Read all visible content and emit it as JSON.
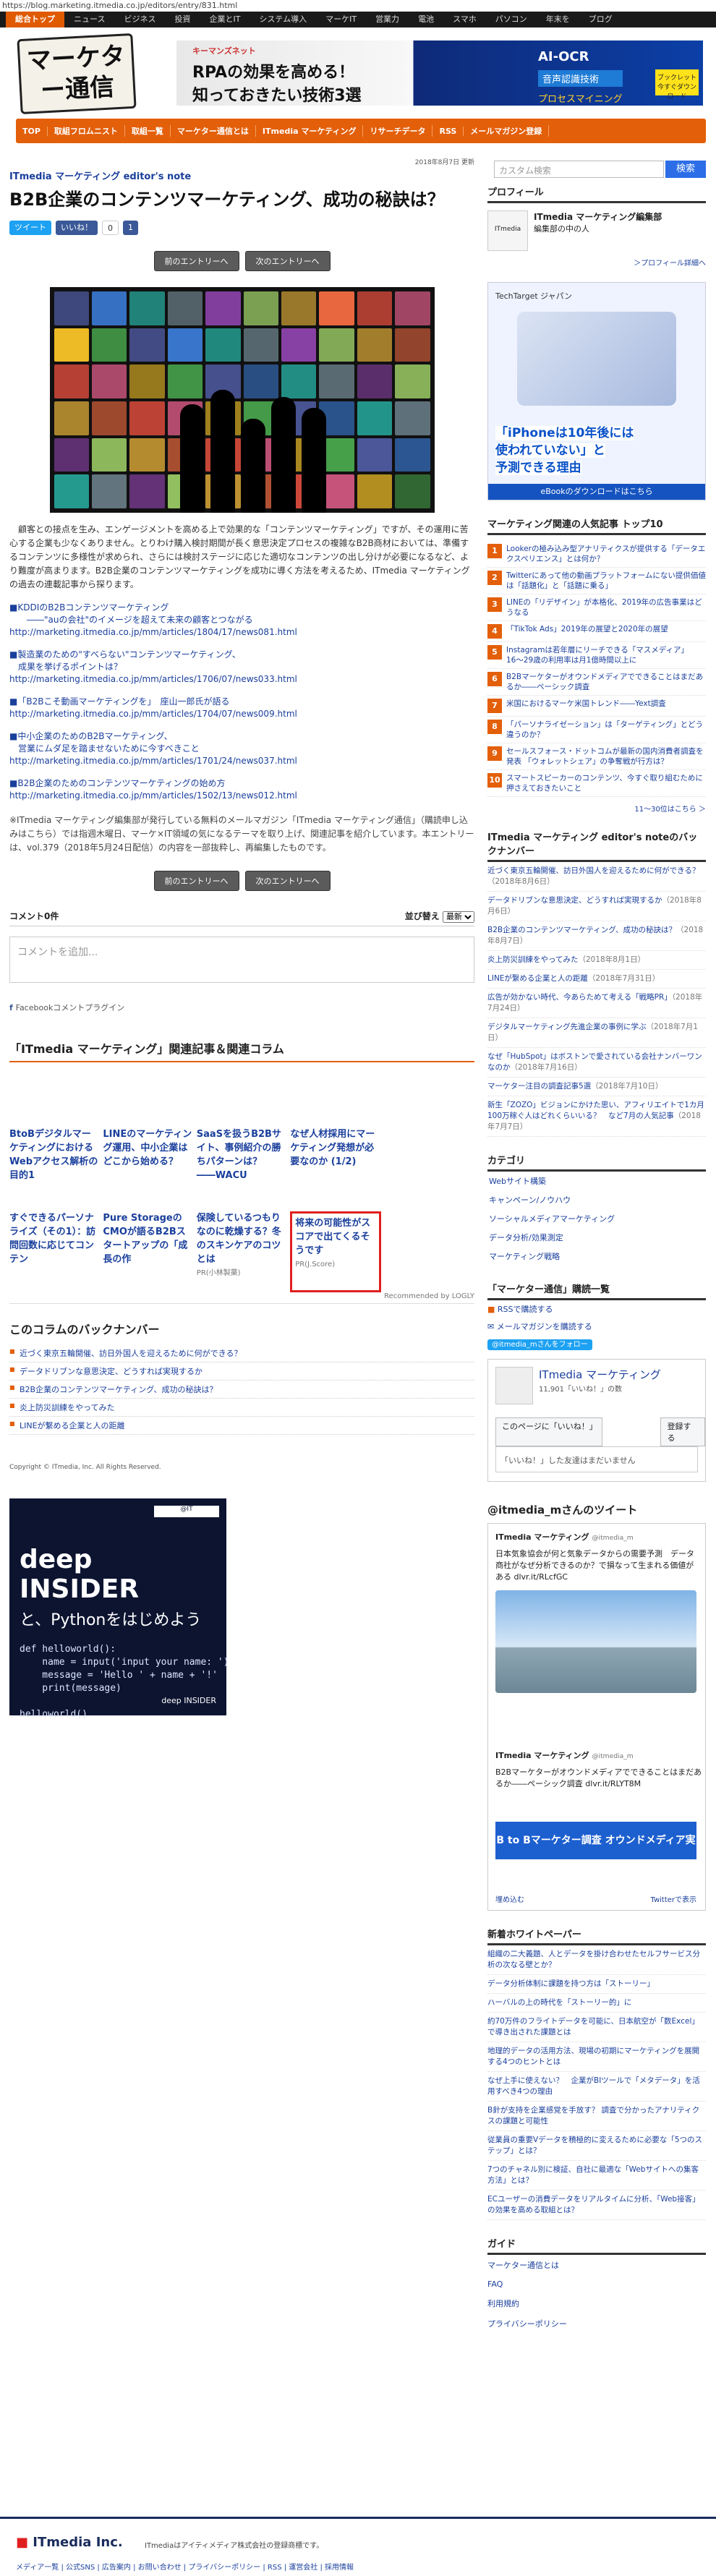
{
  "url": "https://blog.marketing.itmedia.co.jp/editors/entry/831.html",
  "topnav": [
    "総合トップ",
    "ニュース",
    "ビジネス",
    "投資",
    "企業とIT",
    "システム導入",
    "マーケIT",
    "営業力",
    "電池",
    "スマホ",
    "パソコン",
    "年末を",
    "ブログ"
  ],
  "logo_text": "マーケター通信",
  "banner": {
    "brand": "キーマンズネット",
    "line1": "RPAの効果を高める！",
    "line2": "知っておきたい技術3選",
    "ai": "AI-OCR",
    "voice": "音声認識技術",
    "process": "プロセスマイニング",
    "badge": "ブックレット 今すぐダウンロード"
  },
  "catnav": [
    "TOP",
    "取組フロムニスト",
    "取組一覧",
    "マーケター通信とは",
    "ITmedia マーケティング",
    "リサーチデータ",
    "RSS",
    "メールマガジン登録"
  ],
  "date": "2018年8月7日 更新",
  "search": {
    "placeholder": "カスタム検索",
    "button": "検索"
  },
  "blog_name": "ITmedia マーケティング editor's note",
  "title": "B2B企業のコンテンツマーケティング、成功の秘訣は？",
  "social": {
    "tweet": "ツイート",
    "like": "いいね！",
    "like_count": "0",
    "hatena_count": "1"
  },
  "entry_nav": {
    "prev": "前のエントリーへ",
    "next": "次のエントリーへ"
  },
  "body_text": "顧客との接点を生み、エンゲージメントを高める上で効果的な「コンテンツマーケティング」ですが、その運用に苦心する企業も少なくありません。とりわけ購入検討期間が長く意思決定プロセスの複雑なB2B商材においては、準備するコンテンツに多様性が求められ、さらには検討ステージに応じた適切なコンテンツの出し分けが必要になるなど、より難度が高まります。B2B企業のコンテンツマーケティングを成功に導く方法を考えるため、ITmedia マーケティングの過去の連載記事から探ります。",
  "links": [
    {
      "title": "■KDDIのB2Bコンテンツマーケティング\n　　――\"auの会社\"のイメージを超えて未来の顧客とつながる",
      "url": "http://marketing.itmedia.co.jp/mm/articles/1804/17/news081.html"
    },
    {
      "title": "■製造業のための\"すべらない\"コンテンツマーケティング、\n　成果を挙げるポイントは？",
      "url": "http://marketing.itmedia.co.jp/mm/articles/1706/07/news033.html"
    },
    {
      "title": "■「B2Bこそ動画マーケティングを」　座山一郎氏が語る",
      "url": "http://marketing.itmedia.co.jp/mm/articles/1704/07/news009.html"
    },
    {
      "title": "■中小企業のためのB2Bマーケティング、\n　営業にムダ足を踏ませないために今すべきこと",
      "url": "http://marketing.itmedia.co.jp/mm/articles/1701/24/news037.html"
    },
    {
      "title": "■B2B企業のためのコンテンツマーケティングの始め方",
      "url": "http://marketing.itmedia.co.jp/mm/articles/1502/13/news012.html"
    }
  ],
  "note": "※ITmedia マーケティング編集部が発行している無料のメールマガジン「ITmedia マーケティング通信」（購読申し込みはこちら）では指週木曜日、マーケ×IT領域の気になるテーマを取り上げ、関連記事を紹介しています。本エントリーは、vol.379（2018年5月24日配信）の内容を一部抜粋し、再編集したものです。",
  "comments": {
    "count": "コメント0件",
    "sort_label": "並び替え",
    "sort_value": "最新",
    "placeholder": "コメントを追加...",
    "plugin": "Facebookコメントプラグイン"
  },
  "related": {
    "heading": "「ITmedia マーケティング」関連記事＆関連コラム",
    "items": [
      {
        "title": "BtoBデジタルマーケティングにおけるWebアクセス解析の目的1"
      },
      {
        "title": "LINEのマーケティング運用、中小企業はどこから始める？"
      },
      {
        "title": "SaaSを扱うB2Bサイト、事例紹介の勝ちパターンは？――WACU"
      },
      {
        "title": "なぜ人材採用にマーケティング発想が必要なのか (1/2)"
      },
      {
        "title": ""
      },
      {
        "title": "すぐできるパーソナライズ（その1）：訪問回数に応じてコンテン"
      },
      {
        "title": "Pure StorageのCMOが語るB2Bスタートアップの「成長の作"
      },
      {
        "title": "保険しているつもりなのに乾燥する？冬のスキンケアのコツとは",
        "sub": "PR(小林製薬)"
      },
      {
        "title": "将来の可能性がスコアで出てくるそうです",
        "sub": "PR(J.Score)",
        "ad": true
      },
      {
        "title": ""
      }
    ],
    "reco": "Recommended by LOGLY"
  },
  "backnumber": {
    "heading": "このコラムのバックナンバー",
    "items": [
      "近づく東京五輪開催、訪日外国人を迎えるために何ができる？",
      "データドリブンな意思決定、どうすれば実現するか",
      "B2B企業のコンテンツマーケティング、成功の秘訣は？",
      "炎上防災訓練をやってみた",
      "LINEが繋める企業と人の距離"
    ]
  },
  "copyright": "Copyright © ITmedia, Inc. All Rights Reserved.",
  "deep_ad": {
    "brand": "deep INSIDER",
    "sub": "と、Pythonをはじめよう",
    "code": "def helloworld():\n    name = input('input your name: ')\n    message = 'Hello ' + name + '!'\n    print(message)\n\nhelloworld()",
    "logo": "@IT",
    "bottom": "deep INSIDER"
  },
  "profile": {
    "heading": "プロフィール",
    "name": "ITmedia マーケティング編集部",
    "desc": "編集部の中の人",
    "more": "＞プロフィール詳細へ"
  },
  "side_ad": {
    "head": "TechTarget ジャパン",
    "text1": "「iPhoneは10年後には",
    "text2": "使われていない」と",
    "text3": "予測できる理由",
    "foot": "eBookのダウンロードはこちら"
  },
  "ranking": {
    "heading": "マーケティング関連の人気記事 トップ10",
    "items": [
      "Lookerの極み込み型アナリティクスが提供する「データエクスペリエンス」とは何か？",
      "Twitterにあって他の動画プラットフォームにない提供価値は「話題化」と「話題に乗る」",
      "LINEの「リデザイン」が本格化、2019年の広告事業はどうなる",
      "「TikTok Ads」2019年の展望と2020年の展望",
      "Instagramは若年層にリーチできる「マスメディア」　16〜29歳の利用率は月1億時間以上に",
      "B2Bマーケターがオウンドメディアでできることはまだあるか――ペーシック調査",
      "米国におけるマーケ米国トレンド――Yext調査",
      "「パーソナライゼーション」は「ターゲティング」とどう違うのか？",
      "セールスフォース・ドットコムが最新の国内消費者調査を発表 「ウォレットシェア」の争奪戦が行方は？",
      "スマートスピーカーのコンテンツ、今すぐ取り組むために押さえておきたいこと"
    ],
    "more": "11〜30位はこちら ＞"
  },
  "side_backnumber": {
    "heading": "ITmedia マーケティング editor's noteのバックナンバー",
    "items": [
      {
        "t": "近づく東京五輪開催、訪日外国人を迎えるために何ができる？",
        "d": "（2018年8月6日）"
      },
      {
        "t": "データドリブンな意思決定、どうすれば実現するか",
        "d": "（2018年8月6日）"
      },
      {
        "t": "B2B企業のコンテンツマーケティング、成功の秘訣は？",
        "d": "（2018年8月7日）"
      },
      {
        "t": "炎上防災訓練をやってみた",
        "d": "（2018年8月1日）"
      },
      {
        "t": "LINEが繋める企業と人の距離",
        "d": "（2018年7月31日）"
      },
      {
        "t": "広告が効かない時代、今あらためて考える「戦略PR」",
        "d": "（2018年7月24日）"
      },
      {
        "t": "デジタルマーケティング先進企業の事例に学ぶ",
        "d": "（2018年7月1日）"
      },
      {
        "t": "なぜ「HubSpot」はボストンで愛されている会社ナンバーワンなのか",
        "d": "（2018年7月16日）"
      },
      {
        "t": "マーケター注目の調査記事5選",
        "d": "（2018年7月10日）"
      },
      {
        "t": "新生「ZOZO」ビジョンにかけた思い、アフィリエイトで1カ月100万稼ぐ人はどれくらいいる？　など7月の人気記事",
        "d": "（2018年7月7日）"
      }
    ]
  },
  "categories": {
    "heading": "カテゴリ",
    "items": [
      "Webサイト構築",
      "キャンペーン/ノウハウ",
      "ソーシャルメディアマーケティング",
      "データ分析/効果測定",
      "マーケティング戦略"
    ]
  },
  "subscribe": {
    "heading": "「マーケター通信」購読一覧",
    "items": [
      "RSSで購読する",
      "メールマガジンを購読する"
    ],
    "twitter": "@itmedia_mさんをフォロー"
  },
  "fb_box": {
    "name": "ITmedia マーケティング",
    "likes": "11,901「いいね！」の数",
    "like_btn": "このページに「いいね！」",
    "share": "登録する",
    "comment": "「いいね！」した友達はまだいません"
  },
  "twitter": {
    "heading": "@itmedia_mさんのツイート",
    "account": "ITmedia マーケティング",
    "handle": "@itmedia_m",
    "tweet1": "日本気象協会が何と気象データからの需要予測　データ商社がなぜ分析できるのか？で損なって生まれる価値がある dlvr.it/RLcfGC",
    "tweet2": "B2Bマーケターがオウンドメディアでできることはまだあるか――ペーシック調査 dlvr.it/RLYT8M",
    "banner": "B to Bマーケター調査 オウンドメディア実態調査",
    "embed": "埋め込む",
    "view": "Twitterで表示"
  },
  "whitepaper": {
    "heading": "新着ホワイトペーパー",
    "items": [
      "組織の二大義題、人とデータを掛け合わせたセルフサービス分析の次なる壁とか？",
      "データ分析体制に課題を持つ方は「ストーリー」",
      "ハーバルの上の時代を「ストーリー的」に",
      "約70万件のフライトデータを可能に、日本航空が「数Excel」で導き出された課題とは",
      "地理的データの活用方法、現場の初期にマーケティングを展開する4つのヒントとは",
      "なぜ上手に使えない？　企業がBIツールで「メタデータ」を活用すべき4つの理由",
      "B針が支持を企業感覚を手放す？ 調査で分かったアナリティクスの課題と可能性",
      "従業員の重要Vデータを積極的に変えるために必要な「5つのステップ」とは？",
      "7つのチャネル別に検証、自社に最適な「Webサイトへの集客方法」とは？",
      "ECユーザーの消費データをリアルタイムに分析、「Web接客」の効果を高める取組とは？"
    ]
  },
  "guide": {
    "heading": "ガイド",
    "items": [
      "マーケター通信とは",
      "FAQ",
      "利用規約",
      "プライバシーポリシー"
    ]
  },
  "footer": {
    "logo": "ITmedia Inc.",
    "text": "ITmediaはアイティメディア株式会社の登録商標です。",
    "links": "メディア一覧 | 公式SNS | 広告案内 | お問い合わせ | プライバシーポリシー | RSS | 運営会社 | 採用情報"
  },
  "colors": {
    "accent": "#e35f0a",
    "link": "#1a3f9c",
    "brand": "#1a2c5c"
  }
}
